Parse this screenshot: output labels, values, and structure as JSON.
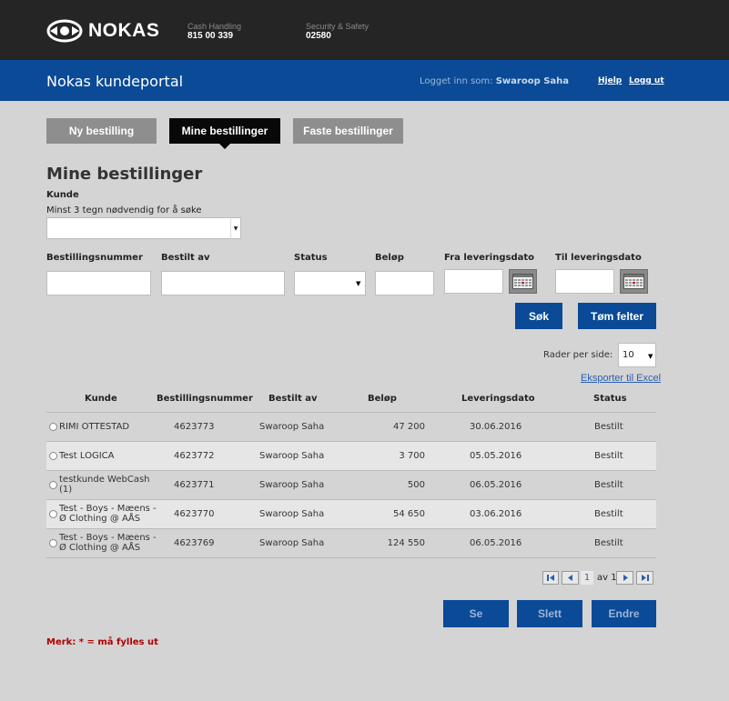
{
  "brand": {
    "name": "NOKAS"
  },
  "contacts": [
    {
      "label": "Cash Handling",
      "value": "815 00 339"
    },
    {
      "label": "Security & Safety",
      "value": "02580"
    }
  ],
  "header": {
    "portal_title": "Nokas kundeportal",
    "logged_in_label": "Logget inn som:",
    "user_name": "Swaroop Saha",
    "help": "Hjelp",
    "logout": "Logg ut"
  },
  "tabs": [
    {
      "label": "Ny bestilling",
      "active": false
    },
    {
      "label": "Mine bestillinger",
      "active": true
    },
    {
      "label": "Faste bestillinger",
      "active": false
    }
  ],
  "page": {
    "title": "Mine bestillinger",
    "kunde_label": "Kunde",
    "kunde_hint": "Minst 3 tegn nødvendig for å søke"
  },
  "filters": {
    "order_number": "Bestillingsnummer",
    "ordered_by": "Bestilt av",
    "status": "Status",
    "amount": "Beløp",
    "from_date": "Fra leveringsdato",
    "to_date": "Til leveringsdato"
  },
  "actions": {
    "search": "Søk",
    "clear": "Tøm felter",
    "rows_per_page_label": "Rader per side:",
    "rows_per_page_value": "10",
    "export": "Eksporter til Excel"
  },
  "table": {
    "columns": [
      "Kunde",
      "Bestillingsnummer",
      "Bestilt av",
      "Beløp",
      "Leveringsdato",
      "Status"
    ],
    "rows": [
      {
        "kunde": "RIMI OTTESTAD",
        "number": "4623773",
        "by": "Swaroop Saha",
        "amount": "47 200",
        "date": "30.06.2016",
        "status": "Bestilt"
      },
      {
        "kunde": "Test LOGICA",
        "number": "4623772",
        "by": "Swaroop Saha",
        "amount": "3 700",
        "date": "05.05.2016",
        "status": "Bestilt"
      },
      {
        "kunde": "testkunde WebCash (1)",
        "number": "4623771",
        "by": "Swaroop Saha",
        "amount": "500",
        "date": "06.05.2016",
        "status": "Bestilt"
      },
      {
        "kunde": "Test - Boys - Mæens - Ø Clothing @ AÅS",
        "number": "4623770",
        "by": "Swaroop Saha",
        "amount": "54 650",
        "date": "03.06.2016",
        "status": "Bestilt"
      },
      {
        "kunde": "Test - Boys - Mæens - Ø Clothing @ AÅS",
        "number": "4623769",
        "by": "Swaroop Saha",
        "amount": "124 550",
        "date": "06.05.2016",
        "status": "Bestilt"
      }
    ]
  },
  "pagination": {
    "current": "1",
    "of_text": "av 1"
  },
  "bottom_actions": {
    "view": "Se",
    "delete": "Slett",
    "edit": "Endre"
  },
  "footer_note": "Merk: * = må fylles ut",
  "colors": {
    "brand_blue": "#0a4a96",
    "topbar": "#252525",
    "note_red": "#b00000"
  }
}
